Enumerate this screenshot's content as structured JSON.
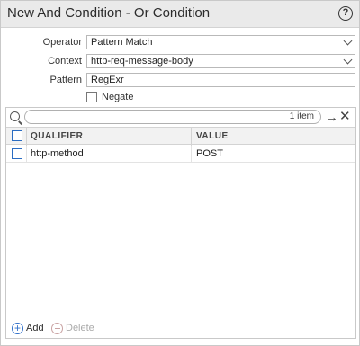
{
  "dialog": {
    "title": "New And Condition - Or Condition",
    "help_icon": "question-circle-icon",
    "help_glyph": "?"
  },
  "form": {
    "operator": {
      "label": "Operator",
      "value": "Pattern Match"
    },
    "context": {
      "label": "Context",
      "value": "http-req-message-body"
    },
    "pattern": {
      "label": "Pattern",
      "value": "RegExr"
    },
    "negate": {
      "label": "Negate",
      "checked": false
    }
  },
  "grid": {
    "search": {
      "placeholder": "",
      "count_text": "1 item"
    },
    "toolbar_icons": {
      "go": "arrow-right-icon",
      "clear": "close-icon",
      "go_glyph": "→",
      "clear_glyph": "✕"
    },
    "columns": [
      "QUALIFIER",
      "VALUE"
    ],
    "rows": [
      {
        "qualifier": "http-method",
        "value": "POST"
      }
    ],
    "footer": {
      "add_label": "Add",
      "add_glyph": "+",
      "delete_label": "Delete"
    }
  },
  "colors": {
    "accent": "#2a6cc2",
    "titlebar": "#eaeaea",
    "header_bg": "#f2f2f2"
  }
}
